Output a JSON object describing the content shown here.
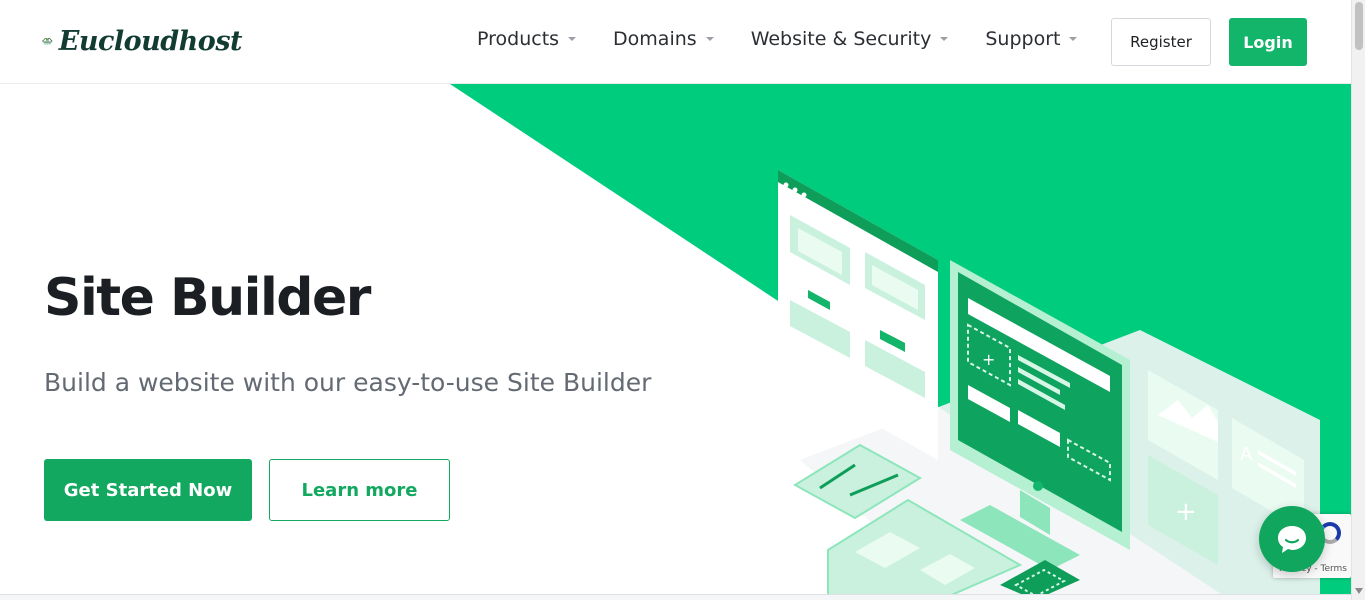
{
  "brand": {
    "name": "Eucloudhost",
    "badge_top": "Eu",
    "badge_bottom": "cloudhost"
  },
  "nav": {
    "items": [
      {
        "label": "Products"
      },
      {
        "label": "Domains"
      },
      {
        "label": "Website & Security"
      },
      {
        "label": "Support"
      }
    ],
    "register_label": "Register",
    "login_label": "Login"
  },
  "hero": {
    "title": "Site Builder",
    "subtitle": "Build a website with our easy-to-use Site Builder",
    "primary_cta": "Get Started Now",
    "secondary_cta": "Learn more"
  },
  "recaptcha": {
    "text": "Privacy - Terms"
  },
  "colors": {
    "accent": "#12b569",
    "hero_green": "#00cc7e",
    "dark_text": "#1b1e22"
  },
  "icons": [
    "caret-down-icon",
    "chat-bubble-icon",
    "recaptcha-icon",
    "cloud-logo-icon"
  ]
}
